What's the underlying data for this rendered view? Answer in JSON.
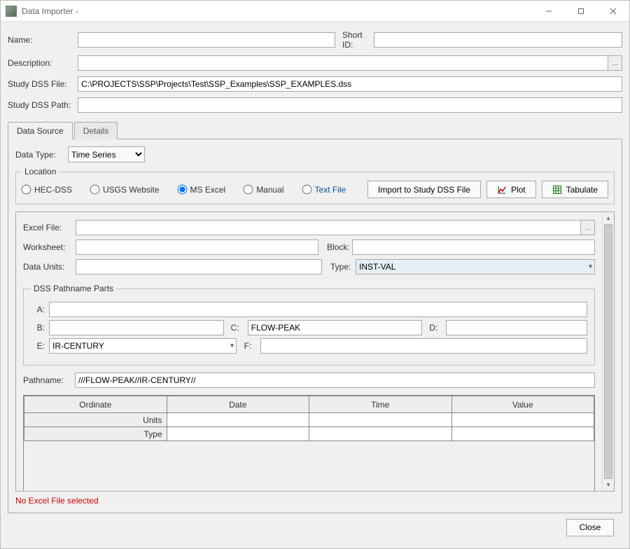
{
  "window": {
    "title": "Data Importer - "
  },
  "form": {
    "labels": {
      "name": "Name:",
      "short_id": "Short ID:",
      "description": "Description:",
      "study_dss_file": "Study DSS File:",
      "study_dss_path": "Study DSS Path:"
    },
    "values": {
      "name": "",
      "short_id": "",
      "description": "",
      "study_dss_file": "C:\\PROJECTS\\SSP\\Projects\\Test\\SSP_Examples\\SSP_EXAMPLES.dss",
      "study_dss_path": ""
    }
  },
  "tabs": {
    "data_source": "Data Source",
    "details": "Details"
  },
  "data_source": {
    "data_type_label": "Data Type:",
    "data_type_value": "Time Series",
    "location": {
      "legend": "Location",
      "options": {
        "hec_dss": "HEC-DSS",
        "usgs": "USGS Website",
        "ms_excel": "MS Excel",
        "manual": "Manual",
        "text_file": "Text File"
      },
      "selected": "ms_excel"
    },
    "buttons": {
      "import": "Import to Study DSS File",
      "plot": "Plot",
      "tabulate": "Tabulate"
    },
    "excel": {
      "labels": {
        "excel_file": "Excel File:",
        "worksheet": "Worksheet:",
        "data_units": "Data Units:",
        "block": "Block:",
        "type": "Type:"
      },
      "values": {
        "excel_file": "",
        "worksheet": "",
        "data_units": "",
        "block": "",
        "type": "INST-VAL"
      }
    },
    "pathparts": {
      "legend": "DSS Pathname Parts",
      "labels": {
        "a": "A:",
        "b": "B:",
        "c": "C:",
        "d": "D:",
        "e": "E:",
        "f": "F:"
      },
      "values": {
        "a": "",
        "b": "",
        "c": "FLOW-PEAK",
        "d": "",
        "e": "IR-CENTURY",
        "f": ""
      }
    },
    "pathname": {
      "label": "Pathname:",
      "value": "///FLOW-PEAK//IR-CENTURY//"
    },
    "table": {
      "columns": {
        "ordinate": "Ordinate",
        "date": "Date",
        "time": "Time",
        "value": "Value"
      },
      "row_headers": {
        "units": "Units",
        "type": "Type"
      }
    },
    "status_message": "No Excel File selected"
  },
  "footer": {
    "close": "Close"
  }
}
